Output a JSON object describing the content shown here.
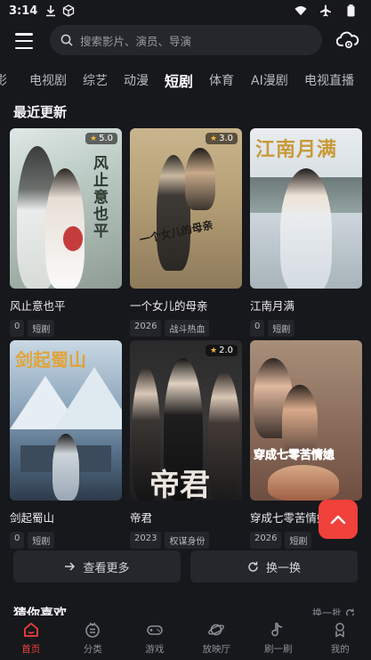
{
  "status": {
    "time": "3:14"
  },
  "search": {
    "placeholder": "搜索影片、演员、导演"
  },
  "tabs": [
    {
      "label": "影"
    },
    {
      "label": "电视剧"
    },
    {
      "label": "综艺"
    },
    {
      "label": "动漫"
    },
    {
      "label": "短剧"
    },
    {
      "label": "体育"
    },
    {
      "label": "AI漫剧"
    },
    {
      "label": "电视直播"
    }
  ],
  "active_tab": "短剧",
  "recent": {
    "title": "最近更新",
    "items": [
      {
        "title": "风止意也平",
        "rating": "5.0",
        "tags": [
          "0",
          "短剧"
        ],
        "poster_text": "风止意也平"
      },
      {
        "title": "一个女儿的母亲",
        "rating": "3.0",
        "tags": [
          "2026",
          "战斗热血"
        ],
        "poster_text": "一个女儿的母亲"
      },
      {
        "title": "江南月满",
        "rating": "",
        "tags": [
          "0",
          "短剧"
        ],
        "poster_text": "江南月满"
      },
      {
        "title": "剑起蜀山",
        "rating": "",
        "tags": [
          "0",
          "短剧"
        ],
        "poster_text": "剑起蜀山"
      },
      {
        "title": "帝君",
        "rating": "2.0",
        "tags": [
          "2023",
          "权谋身份"
        ],
        "poster_text": "帝君"
      },
      {
        "title": "穿成七零苦情媳",
        "rating": "",
        "tags": [
          "2026",
          "短剧"
        ],
        "poster_text": "穿成七零苦情媳"
      }
    ]
  },
  "actions": {
    "more": "查看更多",
    "refresh": "换一换"
  },
  "guess": {
    "title": "猜你喜欢",
    "link": "换一批"
  },
  "nav": [
    {
      "label": "首页",
      "icon": "home-icon"
    },
    {
      "label": "分类",
      "icon": "category-icon"
    },
    {
      "label": "游戏",
      "icon": "gamepad-icon"
    },
    {
      "label": "放映厅",
      "icon": "planet-icon"
    },
    {
      "label": "刷一刷",
      "icon": "music-note-icon"
    },
    {
      "label": "我的",
      "icon": "user-icon"
    }
  ],
  "colors": {
    "accent": "#f0413b",
    "background": "#17181c",
    "card": "#26272c"
  }
}
